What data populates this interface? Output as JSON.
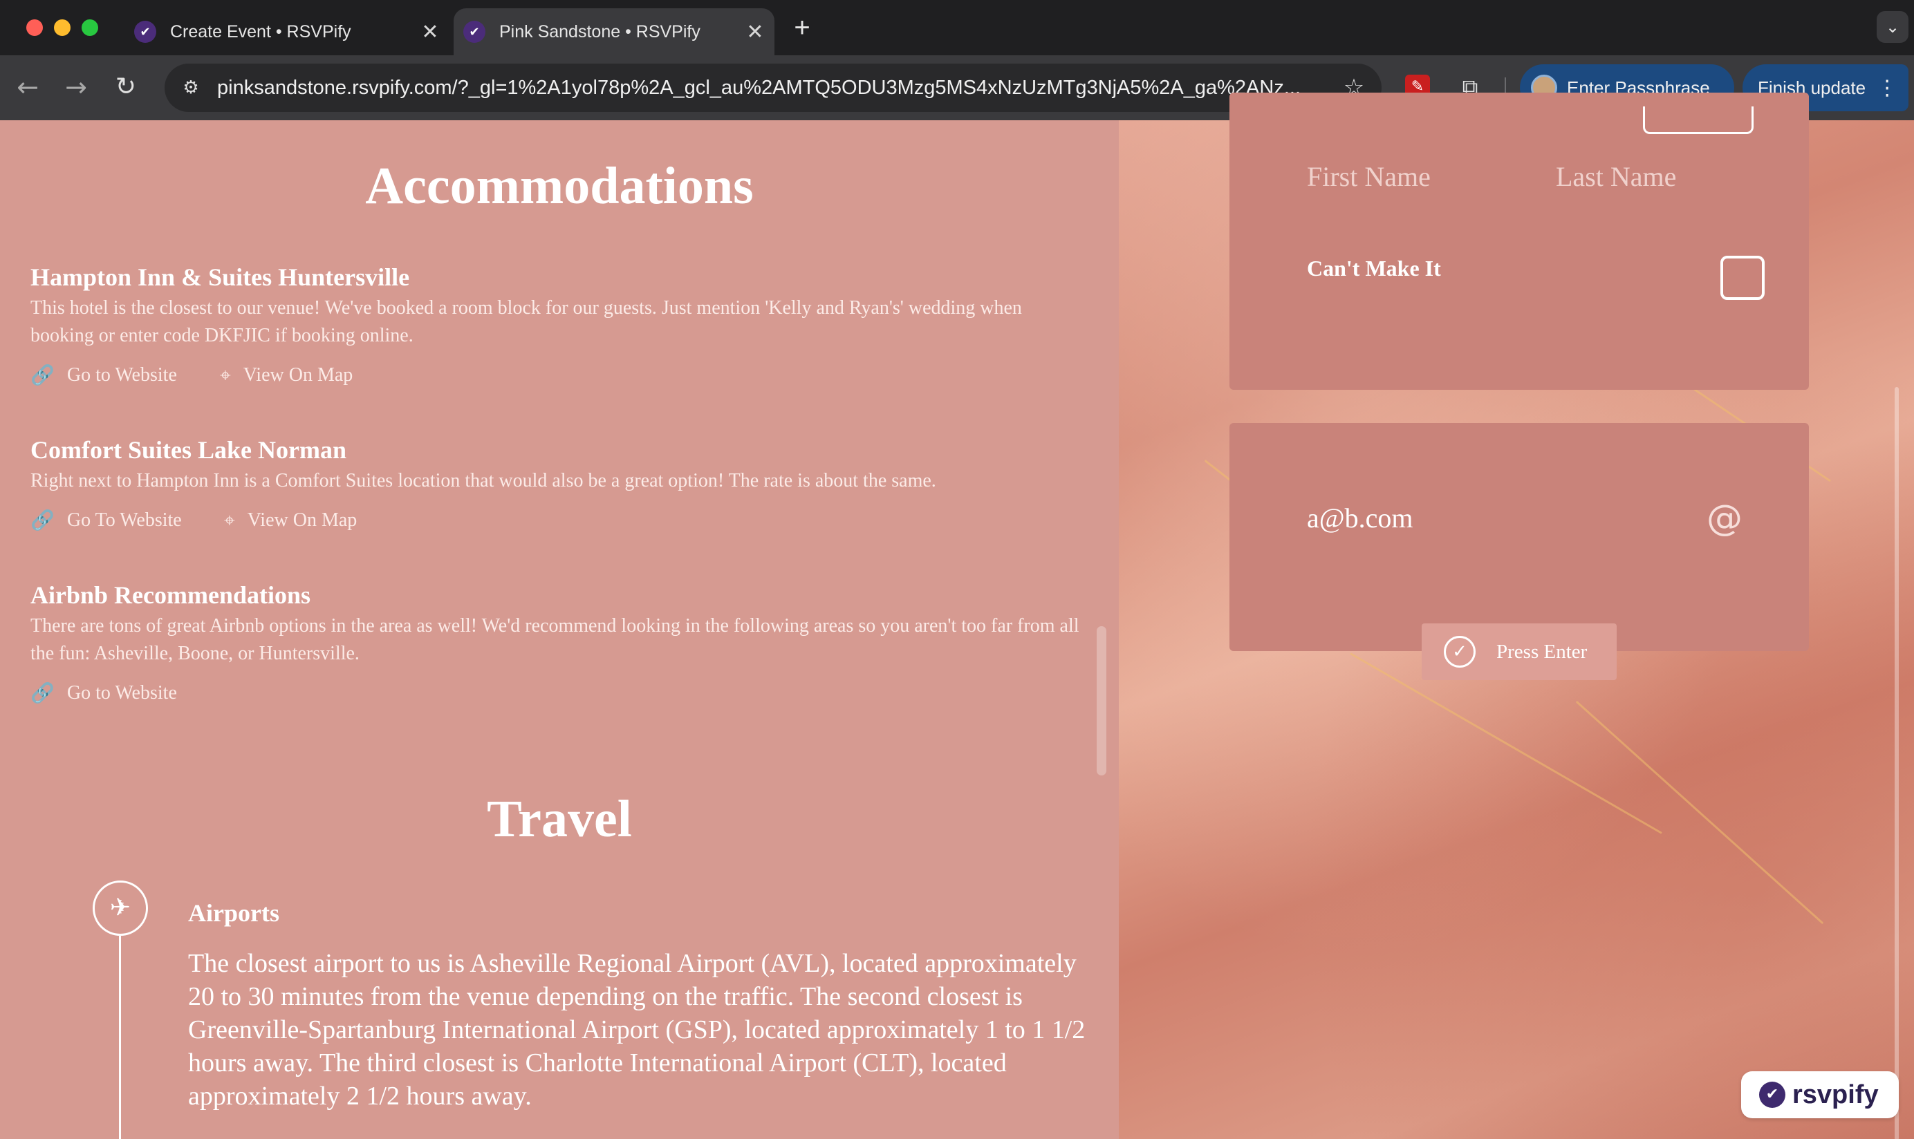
{
  "browser": {
    "tabs": [
      {
        "title": "Create Event • RSVPify",
        "close": "✕"
      },
      {
        "title": "Pink Sandstone • RSVPify",
        "close": "✕"
      }
    ],
    "new_tab": "+",
    "tab_menu_icon": "chevron-down",
    "url": "pinksandstone.rsvpify.com/?_gl=1%2A1yol78p%2A_gcl_au%2AMTQ5ODU3Mzg5MS4xNzUzMTg3NjA5%2A_ga%2ANz...",
    "profile_button": "Enter Passphrase",
    "update_button": "Finish update"
  },
  "accommodations": {
    "heading": "Accommodations",
    "hotels": [
      {
        "name": "Hampton Inn & Suites Huntersville",
        "description": "This hotel is the closest to our venue! We've booked a room block for our guests. Just mention 'Kelly and Ryan's' wedding when booking or enter code DKFJIC if booking online.",
        "website_label": "Go to Website",
        "map_label": "View On Map"
      },
      {
        "name": "Comfort Suites Lake Norman",
        "description": "Right next to Hampton Inn is a Comfort Suites location that would also be a great option! The rate is about the same.",
        "website_label": "Go To Website",
        "map_label": "View On Map"
      },
      {
        "name": "Airbnb Recommendations",
        "description": "There are tons of great Airbnb options in the area as well! We'd recommend looking in the following areas so you aren't too far from all the fun: Asheville, Boone, or Huntersville.",
        "website_label": "Go to Website"
      }
    ]
  },
  "travel": {
    "heading": "Travel",
    "airports_title": "Airports",
    "airports_text": "The closest airport to us is Asheville Regional Airport (AVL), located approximately 20 to 30 minutes from the venue depending on the traffic. The second closest is Greenville-Spartanburg International Airport (GSP), located approximately 1 to 1 1/2 hours away. The third closest is Charlotte International Airport (CLT), located approximately 2 1/2 hours away."
  },
  "rsvp_form": {
    "first_name_placeholder": "First Name",
    "last_name_placeholder": "Last Name",
    "cant_make_it_label": "Can't Make It",
    "email_value": "a@b.com",
    "email_icon": "@",
    "press_enter_label": "Press Enter"
  },
  "badge": {
    "text": "rsvpify"
  },
  "colors": {
    "left_panel_bg": "#d69a91",
    "card_bg": "#c9837a",
    "button_bg": "#dd9f96",
    "chrome_bg": "#1f1f21",
    "profile_btn_bg": "#1c4a80"
  }
}
